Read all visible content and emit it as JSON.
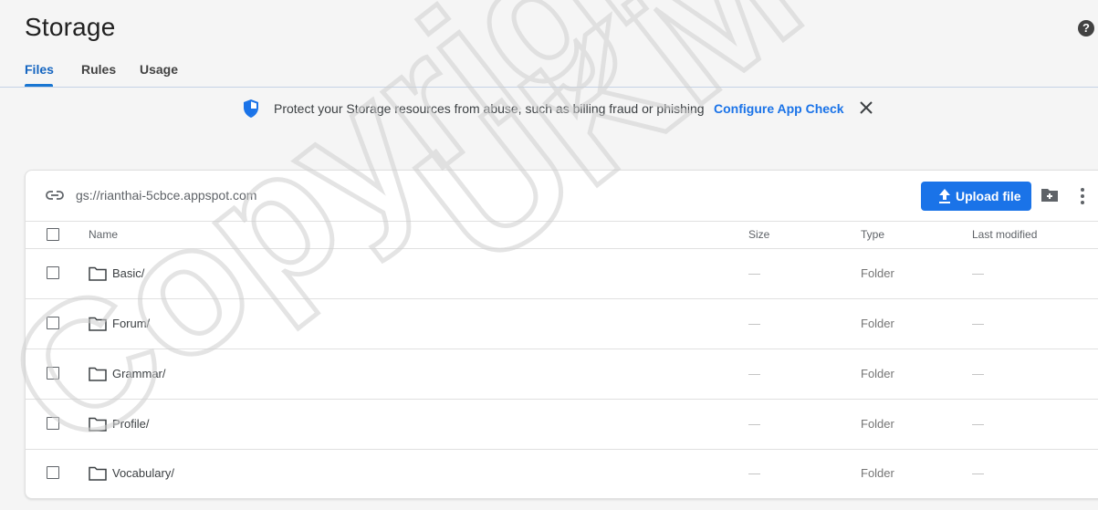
{
  "header": {
    "title": "Storage",
    "help_label": "?"
  },
  "tabs": [
    {
      "label": "Files",
      "active": true
    },
    {
      "label": "Rules",
      "active": false
    },
    {
      "label": "Usage",
      "active": false
    }
  ],
  "banner": {
    "icon": "shield-icon",
    "message": "Protect your Storage resources from abuse, such as billing fraud or phishing",
    "link_label": "Configure App Check",
    "close_icon": "close-icon"
  },
  "bucket": {
    "url": "gs://rianthai-5cbce.appspot.com",
    "upload_label": "Upload file",
    "accent_color": "#1a73e8"
  },
  "table": {
    "columns": {
      "name": "Name",
      "size": "Size",
      "type": "Type",
      "modified": "Last modified"
    },
    "rows": [
      {
        "name": "Basic/",
        "size": "—",
        "type": "Folder",
        "modified": "—"
      },
      {
        "name": "Forum/",
        "size": "—",
        "type": "Folder",
        "modified": "—"
      },
      {
        "name": "Grammar/",
        "size": "—",
        "type": "Folder",
        "modified": "—"
      },
      {
        "name": "Profile/",
        "size": "—",
        "type": "Folder",
        "modified": "—"
      },
      {
        "name": "Vocabulary/",
        "size": "—",
        "type": "Folder",
        "modified": "—"
      }
    ]
  },
  "watermark": {
    "line1": "Copyright",
    "line2": "UKM"
  }
}
